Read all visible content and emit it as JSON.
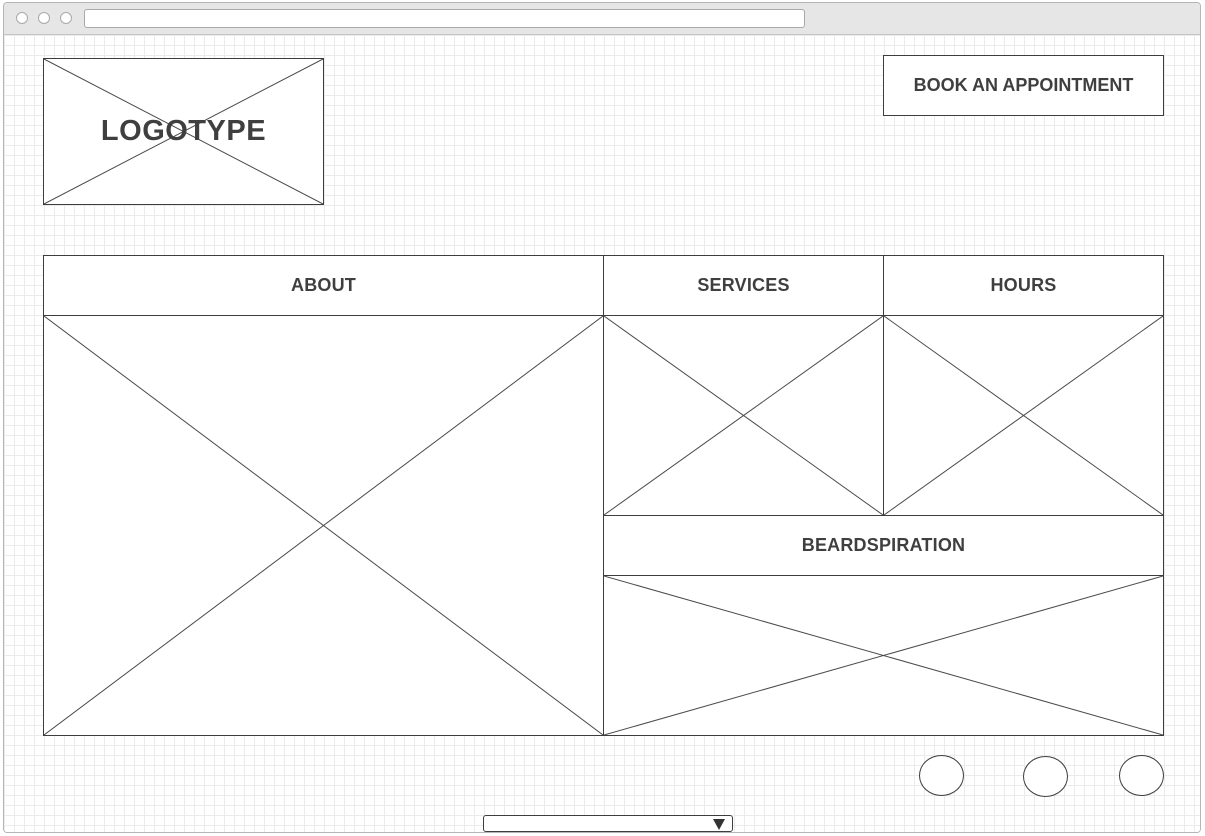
{
  "browser": {
    "address": ""
  },
  "header": {
    "logo_text": "LOGOTYPE",
    "book_button_label": "BOOK AN APPOINTMENT"
  },
  "sections": {
    "about_label": "ABOUT",
    "services_label": "SERVICES",
    "hours_label": "HOURS",
    "beardspiration_label": "BEARDSPIRATION"
  },
  "footer": {
    "social_icons": [
      "circle-icon",
      "circle-icon",
      "circle-icon"
    ],
    "select_value": ""
  },
  "colors": {
    "stroke": "#3d3d3d",
    "text": "#3f3f3f",
    "grid": "#ebebeb",
    "chrome": "#e6e6e6"
  }
}
